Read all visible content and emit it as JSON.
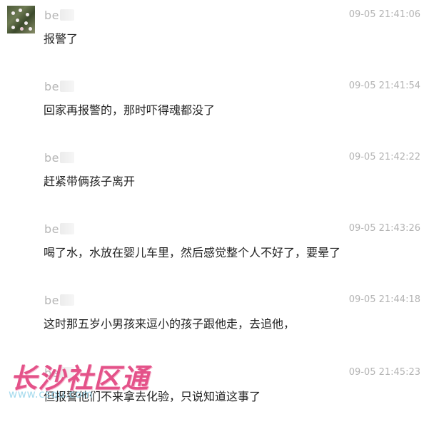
{
  "messages": [
    {
      "sender": "be",
      "time": "09-05 21:41:06",
      "text": "报警了"
    },
    {
      "sender": "be",
      "time": "09-05 21:41:54",
      "text": "回家再报警的，那时吓得魂都没了"
    },
    {
      "sender": "be",
      "time": "09-05 21:42:22",
      "text": "赶紧带俩孩子离开"
    },
    {
      "sender": "be",
      "time": "09-05 21:43:26",
      "text": "喝了水，水放在婴儿车里，然后感觉整个人不好了，要晕了"
    },
    {
      "sender": "be",
      "time": "09-05 21:44:18",
      "text": "这时那五岁小男孩来逗小的孩子跟他走，去追他，"
    },
    {
      "sender": "be",
      "time": "09-05 21:45:23",
      "text": "但报警他们不来拿去化验，只说知道这事了"
    }
  ],
  "watermark": {
    "title": "长沙社区通",
    "url": "www.csqu.com"
  },
  "icons": {
    "avatar": "avatar-flower-photo"
  }
}
